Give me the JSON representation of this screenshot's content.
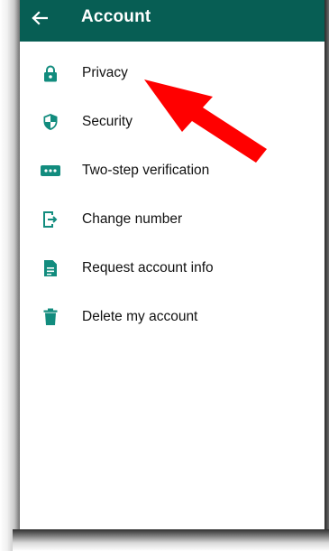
{
  "appbar": {
    "title": "Account",
    "back_icon": "arrow-back-icon",
    "color": "#075e54"
  },
  "accent_color": "#128c7e",
  "menu": {
    "items": [
      {
        "label": "Privacy",
        "icon": "lock-icon"
      },
      {
        "label": "Security",
        "icon": "shield-icon"
      },
      {
        "label": "Two-step verification",
        "icon": "password-dots-icon"
      },
      {
        "label": "Change number",
        "icon": "change-number-icon"
      },
      {
        "label": "Request account info",
        "icon": "document-icon"
      },
      {
        "label": "Delete my account",
        "icon": "trash-icon"
      }
    ]
  },
  "annotation": {
    "arrow_color": "#ff0000",
    "points_to": "Privacy"
  }
}
